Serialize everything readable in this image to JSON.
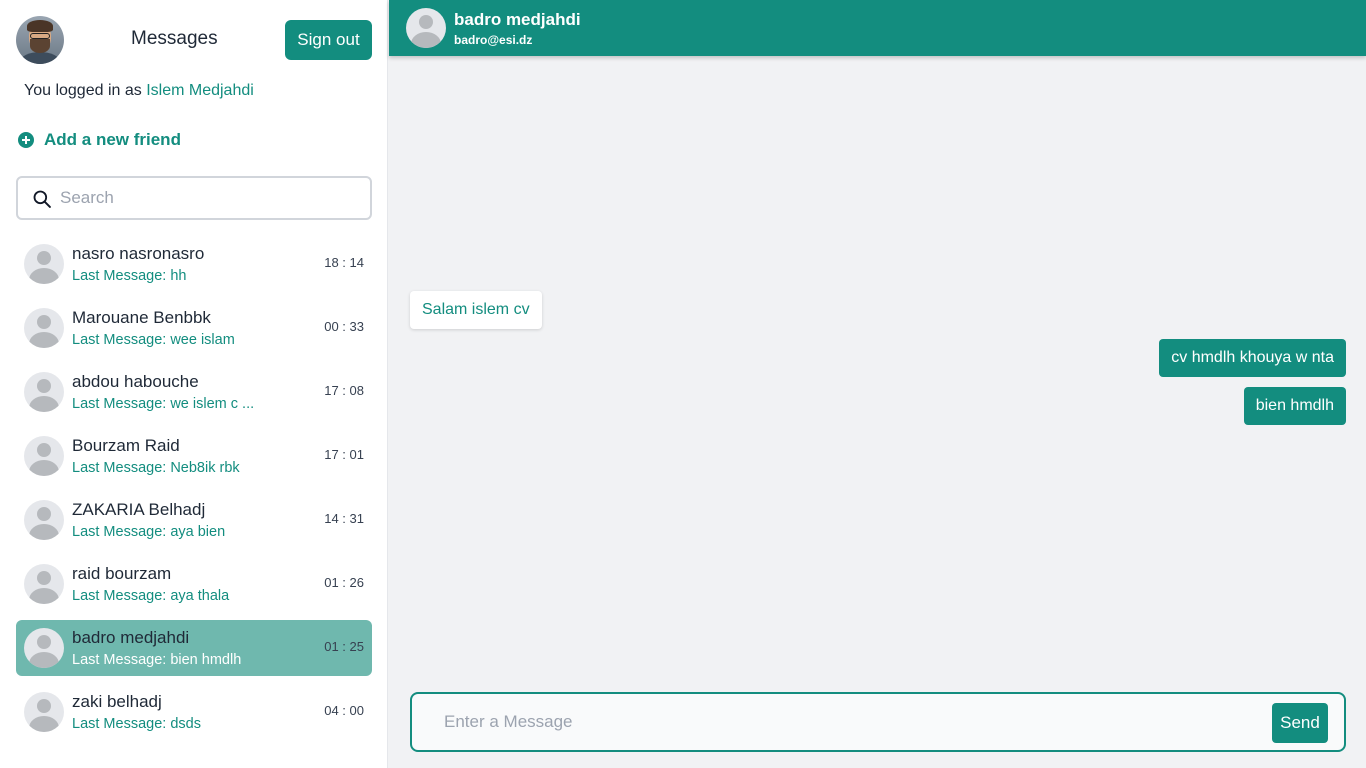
{
  "sidebar": {
    "title": "Messages",
    "sign_out_label": "Sign out",
    "logged_in_prefix": "You logged in as",
    "logged_in_user": "Islem Medjahdi",
    "add_friend_label": "Add a new friend",
    "search_placeholder": "Search",
    "contacts": [
      {
        "name": "nasro nasronasro",
        "last_message": "Last Message: hh",
        "time": "18 : 14",
        "active": false
      },
      {
        "name": "Marouane Benbbk",
        "last_message": "Last Message: wee islam",
        "time": "00 : 33",
        "active": false
      },
      {
        "name": "abdou habouche",
        "last_message": "Last Message: we islem c ...",
        "time": "17 : 08",
        "active": false
      },
      {
        "name": "Bourzam Raid",
        "last_message": "Last Message: Neb8ik rbk",
        "time": "17 : 01",
        "active": false
      },
      {
        "name": "ZAKARIA Belhadj",
        "last_message": "Last Message: aya bien",
        "time": "14 : 31",
        "active": false
      },
      {
        "name": "raid bourzam",
        "last_message": "Last Message: aya thala",
        "time": "01 : 26",
        "active": false
      },
      {
        "name": "badro medjahdi",
        "last_message": "Last Message: bien hmdlh",
        "time": "01 : 25",
        "active": true
      },
      {
        "name": "zaki belhadj",
        "last_message": "Last Message: dsds",
        "time": "04 : 00",
        "active": false
      }
    ]
  },
  "chat": {
    "contact_name": "badro medjahdi",
    "contact_email": "badro@esi.dz",
    "messages": [
      {
        "text": "Salam islem cv",
        "direction": "incoming"
      },
      {
        "text": "cv hmdlh khouya w nta",
        "direction": "outgoing"
      },
      {
        "text": "bien hmdlh",
        "direction": "outgoing"
      }
    ],
    "input_placeholder": "Enter a Message",
    "send_label": "Send"
  },
  "colors": {
    "accent": "#138d7f",
    "active_row": "#6fb8ae",
    "chat_background": "#f1f2f4"
  }
}
